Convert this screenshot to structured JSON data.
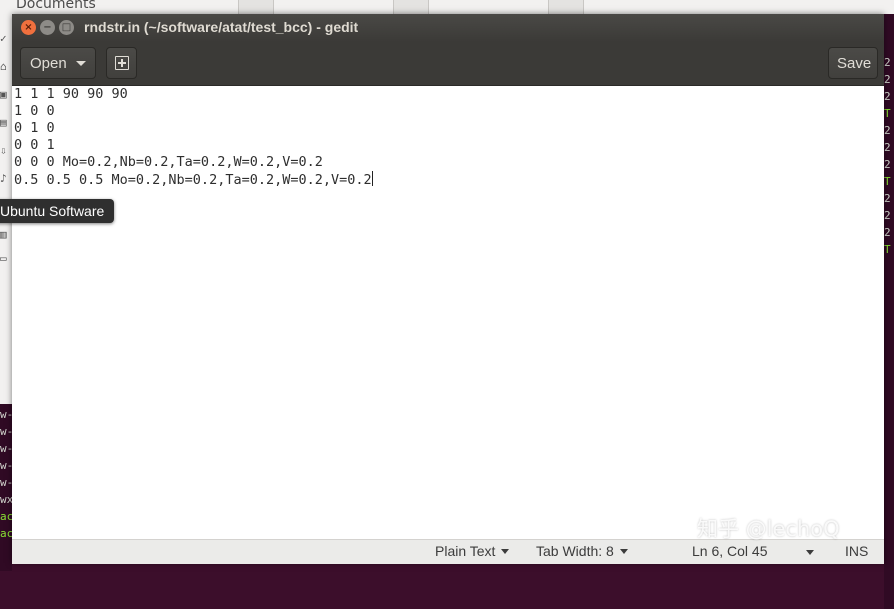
{
  "background": {
    "file_manager": {
      "documents_label": "Documents"
    },
    "left_terminal_lines": [
      "w-",
      "w-",
      "w-",
      "w-",
      "w-",
      "wx",
      "ac",
      "ac"
    ],
    "right_terminal_lines": [
      "2",
      "2",
      "2",
      "T",
      "2",
      "2",
      "2",
      "T",
      "2",
      "2",
      "2",
      "T"
    ]
  },
  "window": {
    "title": "rndstr.in (~/software/atat/test_bcc) - gedit",
    "controls": {
      "close": "×",
      "minimize": "−",
      "maximize": "□"
    }
  },
  "headerbar": {
    "open_label": "Open",
    "new_tab_icon": "new-document-icon",
    "save_label": "Save"
  },
  "editor": {
    "lines": [
      "1 1 1 90 90 90",
      "1 0 0",
      "0 1 0",
      "0 0 1",
      "0 0 0 Mo=0.2,Nb=0.2,Ta=0.2,W=0.2,V=0.2",
      "0.5 0.5 0.5 Mo=0.2,Nb=0.2,Ta=0.2,W=0.2,V=0.2"
    ]
  },
  "statusbar": {
    "language": "Plain Text",
    "tab_width": "Tab Width: 8",
    "position": "Ln 6, Col 45",
    "mode": "INS"
  },
  "tooltip": {
    "text": "Ubuntu Software"
  },
  "watermark": {
    "text": "知乎 @lechoQ"
  },
  "colors": {
    "titlebar": "#3b3a37",
    "close_button": "#f0703e",
    "terminal_bg": "#300a24",
    "terminal_green": "#8ae234"
  }
}
